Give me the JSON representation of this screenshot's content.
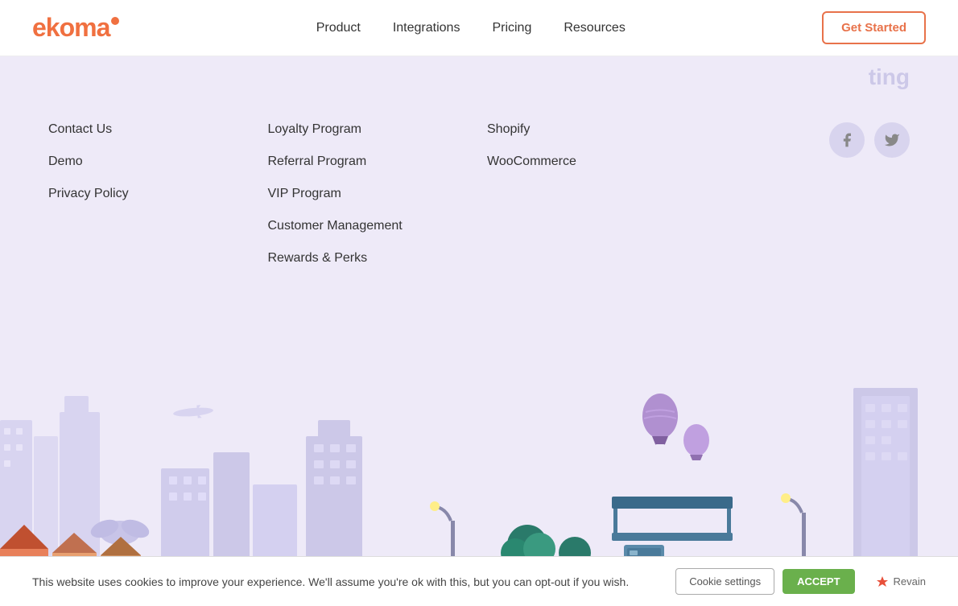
{
  "header": {
    "logo": "ekoma",
    "nav": {
      "items": [
        {
          "label": "Product",
          "id": "product"
        },
        {
          "label": "Integrations",
          "id": "integrations"
        },
        {
          "label": "Pricing",
          "id": "pricing"
        },
        {
          "label": "Resources",
          "id": "resources"
        }
      ]
    },
    "cta": "Get Started"
  },
  "top_partial": {
    "text": "ting"
  },
  "footer": {
    "col1": {
      "links": [
        {
          "label": "Contact Us",
          "id": "contact-us"
        },
        {
          "label": "Demo",
          "id": "demo"
        },
        {
          "label": "Privacy Policy",
          "id": "privacy-policy"
        }
      ]
    },
    "col2": {
      "links": [
        {
          "label": "Loyalty Program",
          "id": "loyalty-program"
        },
        {
          "label": "Referral Program",
          "id": "referral-program"
        },
        {
          "label": "VIP Program",
          "id": "vip-program"
        },
        {
          "label": "Customer Management",
          "id": "customer-management"
        },
        {
          "label": "Rewards & Perks",
          "id": "rewards-perks"
        }
      ]
    },
    "col3": {
      "links": [
        {
          "label": "Shopify",
          "id": "shopify"
        },
        {
          "label": "WooCommerce",
          "id": "woocommerce"
        }
      ]
    },
    "social": {
      "facebook": "f",
      "twitter": "t"
    }
  },
  "cookie": {
    "message": "This website uses cookies to improve your experience. We'll assume you're ok with this, but you can opt-out if you wish.",
    "settings_label": "Cookie settings",
    "accept_label": "ACCEPT",
    "revain_label": "Revain"
  }
}
